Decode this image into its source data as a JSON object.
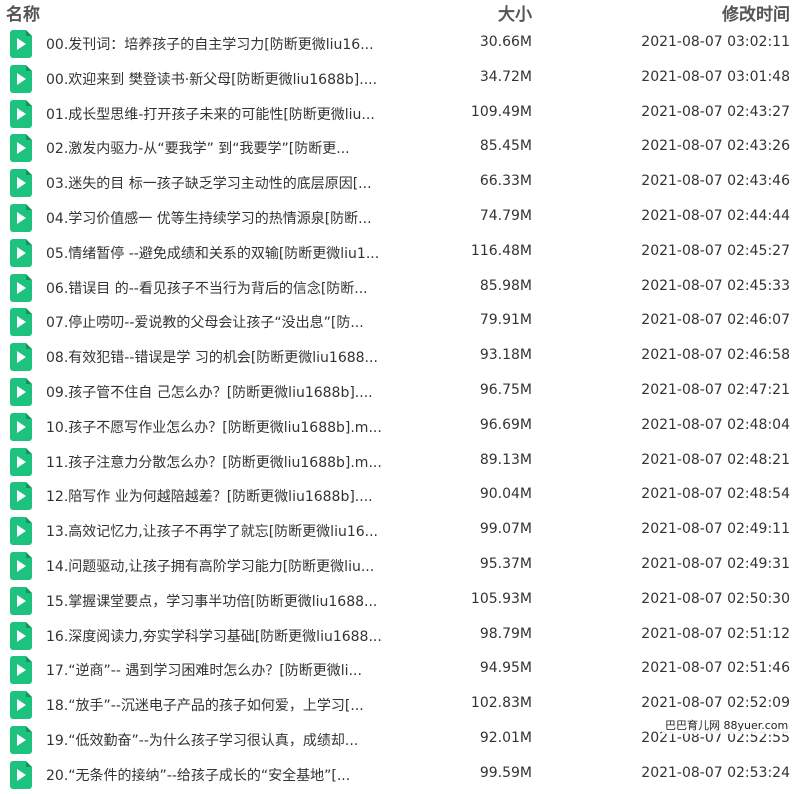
{
  "header": {
    "name": "名称",
    "size": "大小",
    "time": "修改时间"
  },
  "files": [
    {
      "name": "00.发刊词：培养孩子的自主学习力[防断更微liu16...",
      "size": "30.66M",
      "time": "2021-08-07 03:02:11"
    },
    {
      "name": "00.欢迎来到 樊登读书·新父母[防断更微liu1688b]....",
      "size": "34.72M",
      "time": "2021-08-07 03:01:48"
    },
    {
      "name": "01.成长型思维-打开孩子未来的可能性[防断更微liu...",
      "size": "109.49M",
      "time": "2021-08-07 02:43:27"
    },
    {
      "name": "02.激发内驱力-从“要我学” 到“我要学”[防断更...",
      "size": "85.45M",
      "time": "2021-08-07 02:43:26"
    },
    {
      "name": "03.迷失的目 标一孩子缺乏学习主动性的底层原因[...",
      "size": "66.33M",
      "time": "2021-08-07 02:43:46"
    },
    {
      "name": "04.学习价值感一 优等生持续学习的热情源泉[防断...",
      "size": "74.79M",
      "time": "2021-08-07 02:44:44"
    },
    {
      "name": "05.情绪暂停 --避免成绩和关系的双输[防断更微liu1...",
      "size": "116.48M",
      "time": "2021-08-07 02:45:27"
    },
    {
      "name": "06.错误目 的--看见孩子不当行为背后的信念[防断...",
      "size": "85.98M",
      "time": "2021-08-07 02:45:33"
    },
    {
      "name": "07.停止唠叨--爱说教的父母会让孩子“没出息”[防...",
      "size": "79.91M",
      "time": "2021-08-07 02:46:07"
    },
    {
      "name": "08.有效犯错--错误是学 习的机会[防断更微liu1688...",
      "size": "93.18M",
      "time": "2021-08-07 02:46:58"
    },
    {
      "name": "09.孩子管不住自 己怎么办？[防断更微liu1688b]....",
      "size": "96.75M",
      "time": "2021-08-07 02:47:21"
    },
    {
      "name": "10.孩子不愿写作业怎么办？[防断更微liu1688b].m...",
      "size": "96.69M",
      "time": "2021-08-07 02:48:04"
    },
    {
      "name": "11.孩子注意力分散怎么办？[防断更微liu1688b].m...",
      "size": "89.13M",
      "time": "2021-08-07 02:48:21"
    },
    {
      "name": "12.陪写作 业为何越陪越差？[防断更微liu1688b]....",
      "size": "90.04M",
      "time": "2021-08-07 02:48:54"
    },
    {
      "name": "13.高效记忆力,让孩子不再学了就忘[防断更微liu16...",
      "size": "99.07M",
      "time": "2021-08-07 02:49:11"
    },
    {
      "name": "14.问题驱动,让孩子拥有高阶学习能力[防断更微liu...",
      "size": "95.37M",
      "time": "2021-08-07 02:49:31"
    },
    {
      "name": "15.掌握课堂要点，学习事半功倍[防断更微liu1688...",
      "size": "105.93M",
      "time": "2021-08-07 02:50:30"
    },
    {
      "name": "16.深度阅读力,夯实学科学习基础[防断更微liu1688...",
      "size": "98.79M",
      "time": "2021-08-07 02:51:12"
    },
    {
      "name": "17.“逆商”-- 遇到学习困难时怎么办？[防断更微li...",
      "size": "94.95M",
      "time": "2021-08-07 02:51:46"
    },
    {
      "name": "18.“放手”--沉迷电子产品的孩子如何爱，上学习[...",
      "size": "102.83M",
      "time": "2021-08-07 02:52:09"
    },
    {
      "name": "19.“低效勤奋”--为什么孩子学习很认真，成绩却...",
      "size": "92.01M",
      "time": "2021-08-07 02:52:55"
    },
    {
      "name": "20.“无条件的接纳”--给孩子成长的“安全基地”[...",
      "size": "99.59M",
      "time": "2021-08-07 02:53:24"
    }
  ],
  "icon": "video-file-icon",
  "colors": {
    "icon_green": "#1ec27f"
  },
  "watermark": "巴巴育儿网 88yuer.com"
}
